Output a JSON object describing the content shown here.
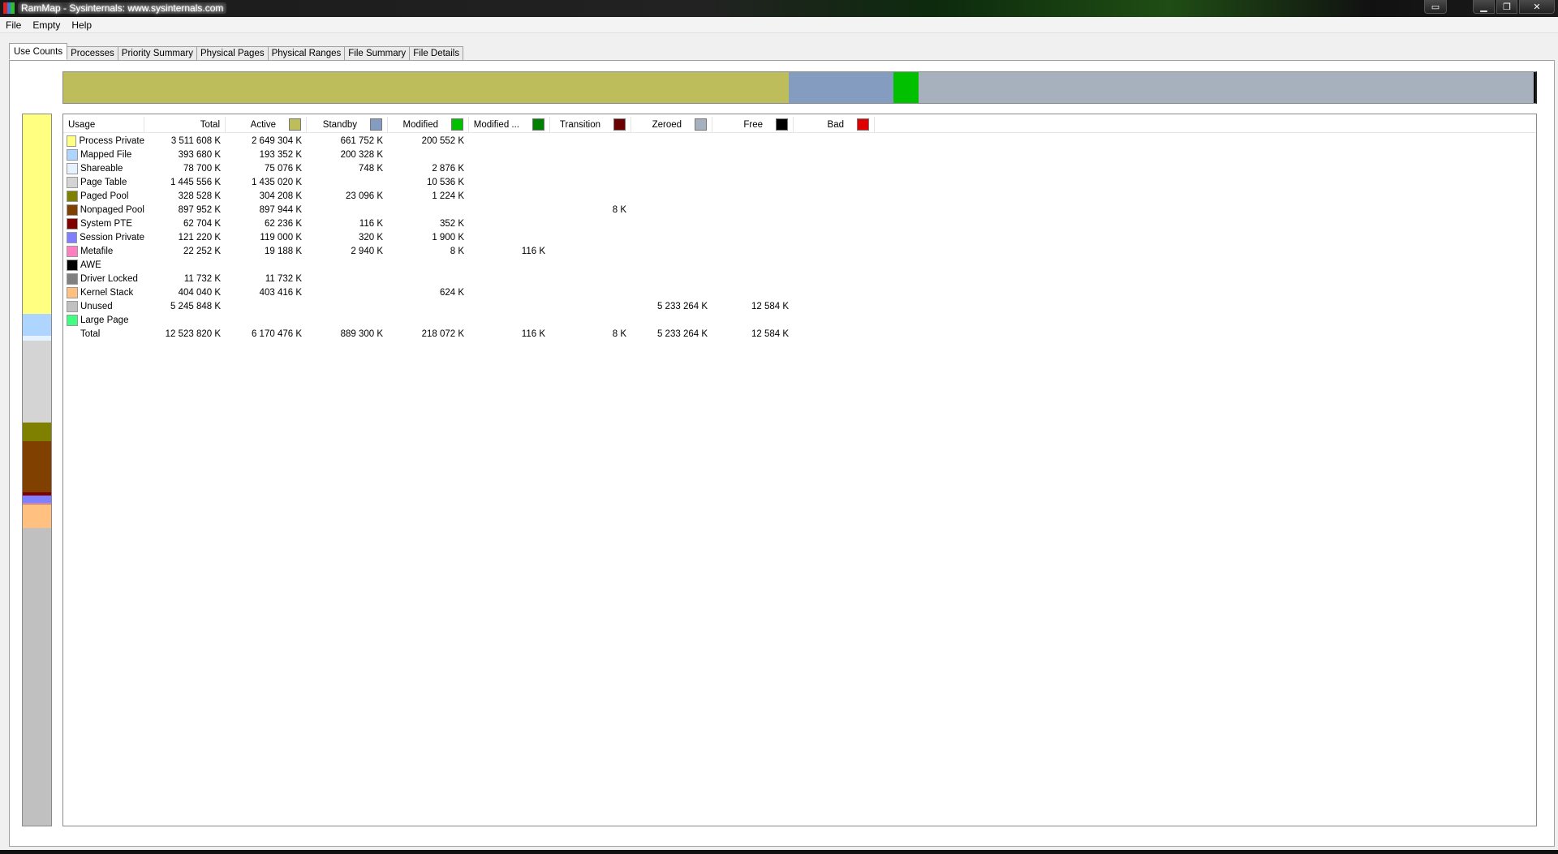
{
  "window": {
    "title": "RamMap - Sysinternals: www.sysinternals.com",
    "icon_colors": [
      "#d22",
      "#3a7de0",
      "#3b3"
    ]
  },
  "menu": [
    "File",
    "Empty",
    "Help"
  ],
  "tabs": [
    "Use Counts",
    "Processes",
    "Priority Summary",
    "Physical Pages",
    "Physical Ranges",
    "File Summary",
    "File Details"
  ],
  "active_tab": "Use Counts",
  "colors": {
    "active": "#bdbd5c",
    "standby": "#849cbf",
    "modified": "#00c000",
    "modified_no_write": "#008000",
    "transition": "#6b0000",
    "zeroed": "#a7b1bd",
    "free": "#000000",
    "bad": "#e00000"
  },
  "topbar_segments": [
    {
      "name": "Active",
      "value": 6170476,
      "color": "#bdbd5c"
    },
    {
      "name": "Standby",
      "value": 889300,
      "color": "#849cbf"
    },
    {
      "name": "Modified",
      "value": 218072,
      "color": "#00c000"
    },
    {
      "name": "Zeroed",
      "value": 5233264,
      "color": "#a7b1bd"
    },
    {
      "name": "Free",
      "value": 12584,
      "color": "#000000"
    }
  ],
  "sidebar_segments": [
    {
      "name": "Process Private",
      "value": 3511608,
      "color": "#ffff80"
    },
    {
      "name": "Mapped File",
      "value": 393680,
      "color": "#add5ff"
    },
    {
      "name": "Shareable",
      "value": 78700,
      "color": "#e6f2ff"
    },
    {
      "name": "Page Table",
      "value": 1445556,
      "color": "#d4d4d4"
    },
    {
      "name": "Paged Pool",
      "value": 328528,
      "color": "#808000"
    },
    {
      "name": "Nonpaged Pool",
      "value": 897952,
      "color": "#804000"
    },
    {
      "name": "System PTE",
      "value": 62704,
      "color": "#800000"
    },
    {
      "name": "Session Private",
      "value": 121220,
      "color": "#8080ff"
    },
    {
      "name": "Metafile",
      "value": 22252,
      "color": "#ff80c0"
    },
    {
      "name": "Driver Locked",
      "value": 11732,
      "color": "#808080"
    },
    {
      "name": "Kernel Stack",
      "value": 404040,
      "color": "#ffc080"
    },
    {
      "name": "Unused",
      "value": 5245848,
      "color": "#c0c0c0"
    }
  ],
  "columns": [
    {
      "label": "Usage",
      "swatch": null
    },
    {
      "label": "Total",
      "swatch": null
    },
    {
      "label": "Active",
      "swatch": "#bdbd5c"
    },
    {
      "label": "Standby",
      "swatch": "#849cbf"
    },
    {
      "label": "Modified",
      "swatch": "#00c000"
    },
    {
      "label": "Modified ...",
      "swatch": "#008000"
    },
    {
      "label": "Transition",
      "swatch": "#6b0000"
    },
    {
      "label": "Zeroed",
      "swatch": "#a7b1bd"
    },
    {
      "label": "Free",
      "swatch": "#000000"
    },
    {
      "label": "Bad",
      "swatch": "#e00000"
    }
  ],
  "rows": [
    {
      "label": "Process Private",
      "color": "#ffff80",
      "cells": [
        "3 511 608 K",
        "2 649 304 K",
        "661 752 K",
        "200 552 K",
        "",
        "",
        "",
        "",
        ""
      ]
    },
    {
      "label": "Mapped File",
      "color": "#add5ff",
      "cells": [
        "393 680 K",
        "193 352 K",
        "200 328 K",
        "",
        "",
        "",
        "",
        "",
        ""
      ]
    },
    {
      "label": "Shareable",
      "color": "#e6f2ff",
      "cells": [
        "78 700 K",
        "75 076 K",
        "748 K",
        "2 876 K",
        "",
        "",
        "",
        "",
        ""
      ]
    },
    {
      "label": "Page Table",
      "color": "#d4d4d4",
      "cells": [
        "1 445 556 K",
        "1 435 020 K",
        "",
        "10 536 K",
        "",
        "",
        "",
        "",
        ""
      ]
    },
    {
      "label": "Paged Pool",
      "color": "#808000",
      "cells": [
        "328 528 K",
        "304 208 K",
        "23 096 K",
        "1 224 K",
        "",
        "",
        "",
        "",
        ""
      ]
    },
    {
      "label": "Nonpaged Pool",
      "color": "#804000",
      "cells": [
        "897 952 K",
        "897 944 K",
        "",
        "",
        "",
        "8 K",
        "",
        "",
        ""
      ]
    },
    {
      "label": "System PTE",
      "color": "#800000",
      "cells": [
        "62 704 K",
        "62 236 K",
        "116 K",
        "352 K",
        "",
        "",
        "",
        "",
        ""
      ]
    },
    {
      "label": "Session Private",
      "color": "#8080ff",
      "cells": [
        "121 220 K",
        "119 000 K",
        "320 K",
        "1 900 K",
        "",
        "",
        "",
        "",
        ""
      ]
    },
    {
      "label": "Metafile",
      "color": "#ff80c0",
      "cells": [
        "22 252 K",
        "19 188 K",
        "2 940 K",
        "8 K",
        "116 K",
        "",
        "",
        "",
        ""
      ]
    },
    {
      "label": "AWE",
      "color": "#000000",
      "cells": [
        "",
        "",
        "",
        "",
        "",
        "",
        "",
        "",
        ""
      ]
    },
    {
      "label": "Driver Locked",
      "color": "#808080",
      "cells": [
        "11 732 K",
        "11 732 K",
        "",
        "",
        "",
        "",
        "",
        "",
        ""
      ]
    },
    {
      "label": "Kernel Stack",
      "color": "#ffc080",
      "cells": [
        "404 040 K",
        "403 416 K",
        "",
        "624 K",
        "",
        "",
        "",
        "",
        ""
      ]
    },
    {
      "label": "Unused",
      "color": "#c0c0c0",
      "cells": [
        "5 245 848 K",
        "",
        "",
        "",
        "",
        "",
        "5 233 264 K",
        "12 584 K",
        ""
      ]
    },
    {
      "label": "Large Page",
      "color": "#40ff80",
      "cells": [
        "",
        "",
        "",
        "",
        "",
        "",
        "",
        "",
        ""
      ]
    },
    {
      "label": "Total",
      "color": null,
      "cells": [
        "12 523 820 K",
        "6 170 476 K",
        "889 300 K",
        "218 072 K",
        "116 K",
        "8 K",
        "5 233 264 K",
        "12 584 K",
        ""
      ]
    }
  ]
}
